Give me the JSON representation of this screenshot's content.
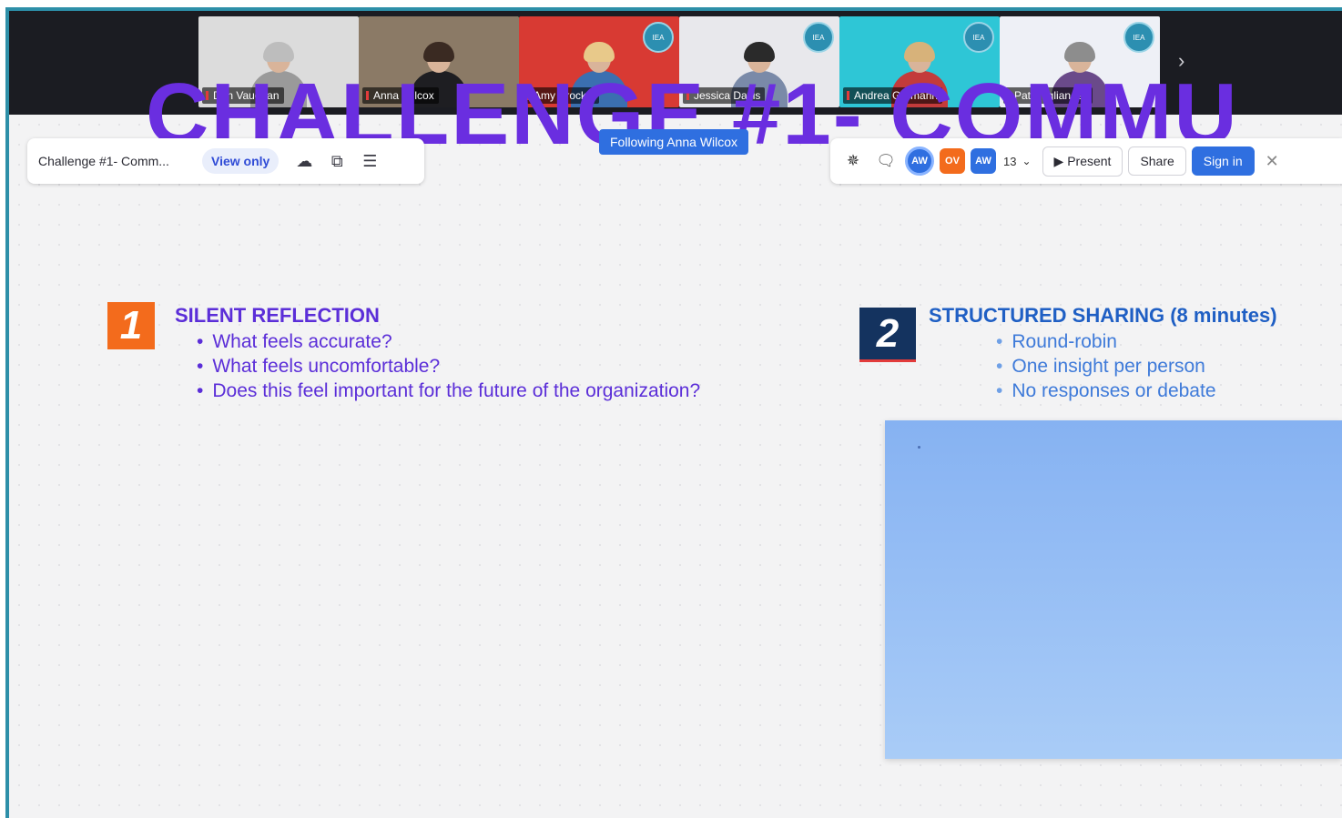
{
  "video_strip": {
    "participants": [
      {
        "name": "Don Vaughan",
        "bg": "#dcdcdc",
        "hair": "#bdbdbd",
        "shirt": "#9a9a9a",
        "badge": false,
        "active": false
      },
      {
        "name": "Anna Wilcox",
        "bg": "#8b7a66",
        "hair": "#3a2a22",
        "shirt": "#1e1e22",
        "badge": false,
        "active": true
      },
      {
        "name": "Amy Brockel",
        "bg": "#d83a33",
        "hair": "#e8c98a",
        "shirt": "#3b6fb0",
        "badge": true,
        "active": false
      },
      {
        "name": "Jessica Davis",
        "bg": "#e8e8ec",
        "hair": "#2a2a2a",
        "shirt": "#7a8aa8",
        "badge": true,
        "active": false
      },
      {
        "name": "Andrea Germann",
        "bg": "#2ec6d6",
        "hair": "#d7b27a",
        "shirt": "#c33b3b",
        "badge": true,
        "active": false
      },
      {
        "name": "Pat Coglianese",
        "bg": "#eef0f6",
        "hair": "#8d8d8d",
        "shirt": "#6a4a8a",
        "badge": true,
        "active": false
      }
    ],
    "badge_text": "IEA",
    "next_icon": "chevron-right-icon"
  },
  "board": {
    "big_title": "CHALLENGE #1- COMMU",
    "name": "Challenge #1- Comm...",
    "view_only_label": "View only",
    "following_label": "Following Anna Wilcox"
  },
  "toolbar": {
    "avatars": [
      "AW",
      "OV",
      "AW"
    ],
    "count": "13",
    "present_label": "Present",
    "share_label": "Share",
    "signin_label": "Sign in"
  },
  "step1": {
    "number": "1",
    "title": "SILENT REFLECTION",
    "bullets": [
      "What feels accurate?",
      "What feels uncomfortable?",
      "Does this feel important for the future of the organization?"
    ]
  },
  "step2": {
    "number": "2",
    "title": "STRUCTURED SHARING (8 minutes)",
    "bullets": [
      "Round-robin",
      "One insight per person",
      "No responses or debate"
    ]
  },
  "colors": {
    "accent": "#6a2ee0",
    "brand_blue": "#2f6fe0",
    "step1": "#f36b1c",
    "step2": "#14335f"
  }
}
